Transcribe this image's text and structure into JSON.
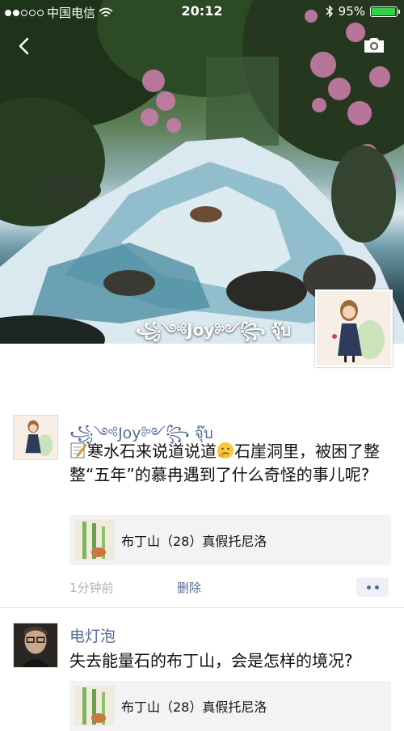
{
  "status_bar": {
    "carrier": "中国电信",
    "time": "20:12",
    "battery": "95%",
    "battery_level": 0.95
  },
  "cover": {
    "display_name": "꧁༺Joy༻꧂ จุ๊บ"
  },
  "posts": [
    {
      "author": "꧁༺Joy༻꧂ จุ๊บ",
      "text_part1": "寒水石来说道说道",
      "text_part2": "石崖洞里，被困了整整“五年”的慕冉遇到了什么奇怪的事儿呢?",
      "link_title": "布丁山（28）真假托尼洛",
      "time": "1分钟前",
      "delete_label": "删除"
    },
    {
      "author": "电灯泡",
      "text": "失去能量石的布丁山，会是怎样的境况?",
      "link_title": "布丁山（28）真假托尼洛"
    }
  ],
  "icons": {
    "back": "chevron-left-icon",
    "camera": "camera-icon",
    "wifi": "wifi-icon",
    "bluetooth": "bluetooth-icon",
    "more": "more-dots-icon"
  },
  "colors": {
    "link_name": "#576b95",
    "battery_fill": "#35d04a",
    "card_bg": "#f3f3f5"
  }
}
